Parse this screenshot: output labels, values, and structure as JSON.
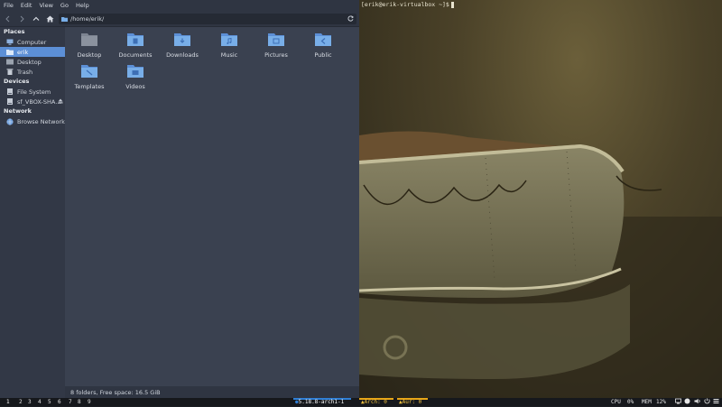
{
  "menu": [
    "File",
    "Edit",
    "View",
    "Go",
    "Help"
  ],
  "path": "/home/erik/",
  "sidebar": {
    "places_header": "Places",
    "places": [
      {
        "label": "Computer",
        "icon": "computer-icon"
      },
      {
        "label": "erik",
        "icon": "home-icon",
        "active": true
      },
      {
        "label": "Desktop",
        "icon": "desktop-icon"
      },
      {
        "label": "Trash",
        "icon": "trash-icon"
      }
    ],
    "devices_header": "Devices",
    "devices": [
      {
        "label": "File System",
        "icon": "drive-icon"
      },
      {
        "label": "sf_VBOX-SHA...",
        "icon": "drive-icon"
      }
    ],
    "network_header": "Network",
    "network": [
      {
        "label": "Browse Network",
        "icon": "network-icon"
      }
    ]
  },
  "folders": [
    {
      "name": "Desktop",
      "icon": "folder-desktop-icon"
    },
    {
      "name": "Documents",
      "icon": "folder-documents-icon"
    },
    {
      "name": "Downloads",
      "icon": "folder-downloads-icon"
    },
    {
      "name": "Music",
      "icon": "folder-music-icon"
    },
    {
      "name": "Pictures",
      "icon": "folder-pictures-icon"
    },
    {
      "name": "Public",
      "icon": "folder-public-icon"
    },
    {
      "name": "Templates",
      "icon": "folder-templates-icon"
    },
    {
      "name": "Videos",
      "icon": "folder-videos-icon"
    }
  ],
  "status": "8 folders, Free space: 16.5 GiB",
  "terminal": {
    "prompt": "[erik@erik-virtualbox ~]$"
  },
  "panel": {
    "workspaces": [
      "1",
      "2",
      "3",
      "4",
      "5",
      "6",
      "7",
      "8",
      "9"
    ],
    "kernel": "5.18.8-arch1-1",
    "arch_updates": "Arch: 0",
    "aur_updates": "Aur: 0",
    "cpu_label": "CPU",
    "cpu_value": "0%",
    "mem_label": "MEM",
    "mem_value": "12%"
  },
  "colors": {
    "accent": "#5c8fd6",
    "folder": "#78aee8",
    "kernel": "#2f7fd6",
    "updates": "#e8a617"
  }
}
